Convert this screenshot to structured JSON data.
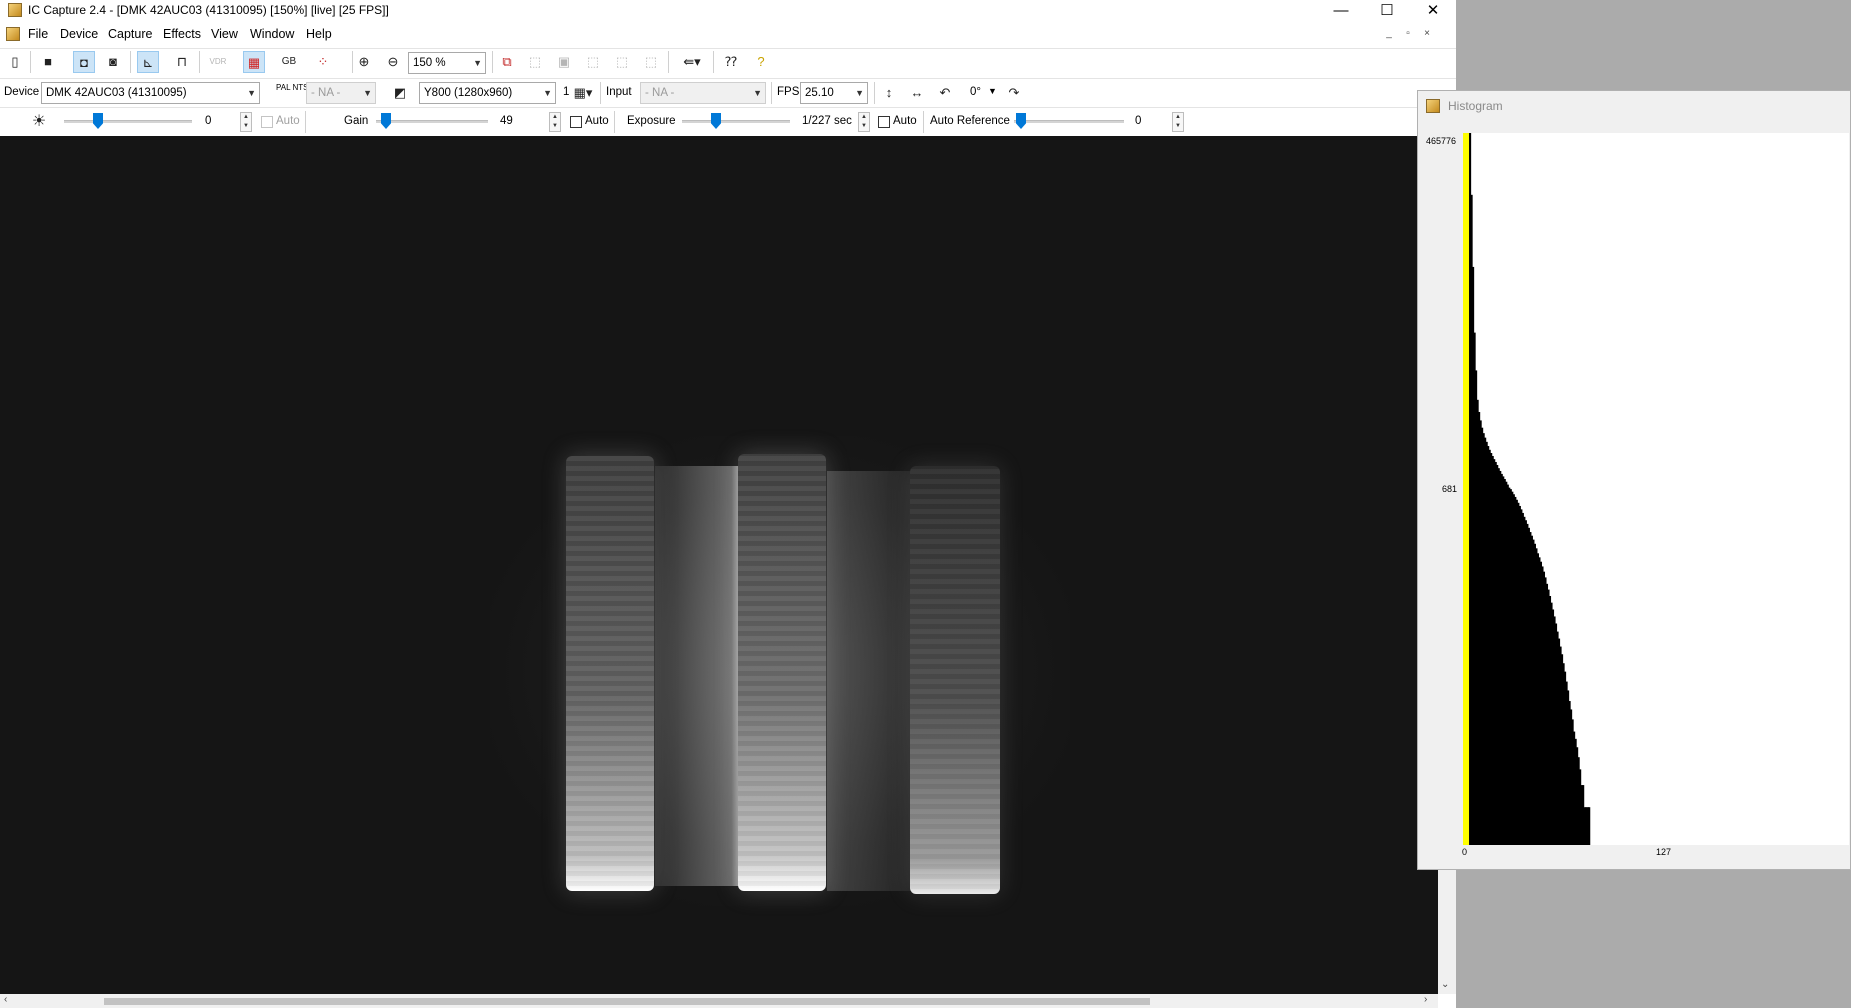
{
  "window": {
    "title": "IC Capture 2.4 - [DMK 42AUC03 (41310095) [150%]  [live]  [25 FPS]]",
    "minimize_glyph": "—",
    "maximize_glyph": "☐",
    "close_glyph": "✕"
  },
  "menu": [
    "File",
    "Device",
    "Capture",
    "Effects",
    "View",
    "Window",
    "Help"
  ],
  "mdi_controls": [
    "_",
    "▫",
    "×"
  ],
  "toolbar1": {
    "zoom_value": "150 %",
    "color_format_label": "GB",
    "vdr_label": "VDR"
  },
  "toolbar2": {
    "device_label": "Device",
    "device_value": "DMK 42AUC03 (41310095)",
    "video_norm_label": "PAL NTSC",
    "video_norm_value": "- NA -",
    "video_format_value": "Y800 (1280x960)",
    "binning_value": "1",
    "input_label": "Input",
    "input_value": "- NA -",
    "fps_label": "FPS",
    "fps_value": "25.10",
    "rotation_value": "0°"
  },
  "toolbar3": {
    "brightness_value": "0",
    "brightness_level": 0.25,
    "brightness_auto_label": "Auto",
    "gain_label": "Gain",
    "gain_value": "49",
    "gain_level": 0.05,
    "gain_auto_label": "Auto",
    "exposure_label": "Exposure",
    "exposure_value": "1/227 sec",
    "exposure_level": 0.3,
    "exposure_auto_label": "Auto",
    "auto_reference_label": "Auto Reference",
    "auto_reference_value": "0",
    "auto_reference_level": 0.0
  },
  "histogram": {
    "title": "Histogram",
    "y_max_label": "465776",
    "y_mid_label": "681",
    "x_min_label": "0",
    "x_mid_label": "127",
    "colors": {
      "highlight": "#ffff00",
      "bars": "#000000"
    }
  },
  "chart_data": {
    "type": "bar",
    "title": "Histogram",
    "log_scale": true,
    "x_range": [
      0,
      255
    ],
    "y_range": [
      1,
      465776
    ],
    "bars_from_x": 4,
    "values": [
      465776,
      150000,
      40000,
      12000,
      6000,
      3500,
      2800,
      2400,
      2100,
      1900,
      1750,
      1620,
      1500,
      1400,
      1320,
      1250,
      1180,
      1120,
      1060,
      1000,
      950,
      900,
      860,
      820,
      780,
      740,
      700,
      681,
      650,
      620,
      590,
      560,
      530,
      500,
      470,
      440,
      410,
      385,
      360,
      335,
      310,
      290,
      270,
      250,
      230,
      210,
      195,
      180,
      165,
      150,
      135,
      120,
      108,
      96,
      85,
      75,
      66,
      58,
      50,
      44,
      38,
      33,
      28,
      24,
      20,
      17,
      14,
      12,
      10,
      8,
      7,
      6,
      5,
      4,
      3,
      3,
      2,
      2,
      2,
      2,
      1,
      1,
      1,
      1,
      1,
      1,
      1,
      1,
      1,
      1,
      1,
      1,
      1,
      1,
      1
    ]
  }
}
